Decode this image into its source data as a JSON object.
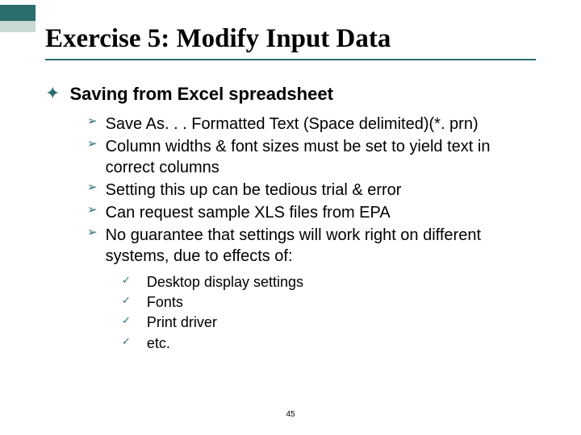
{
  "title": "Exercise 5: Modify Input Data",
  "level1": {
    "text": "Saving from Excel spreadsheet"
  },
  "level2": [
    {
      "text": "Save As. . . Formatted Text (Space delimited)(*. prn)"
    },
    {
      "text": "Column widths & font sizes must be set to yield text in correct columns"
    },
    {
      "text": "Setting this up can be tedious trial & error"
    },
    {
      "text": "Can request sample XLS files from EPA"
    },
    {
      "text": "No guarantee that settings will work right on different systems, due to effects of:"
    }
  ],
  "level3": [
    {
      "text": "Desktop display settings"
    },
    {
      "text": "Fonts"
    },
    {
      "text": "Print driver"
    },
    {
      "text": "etc."
    }
  ],
  "pageNumber": "45"
}
